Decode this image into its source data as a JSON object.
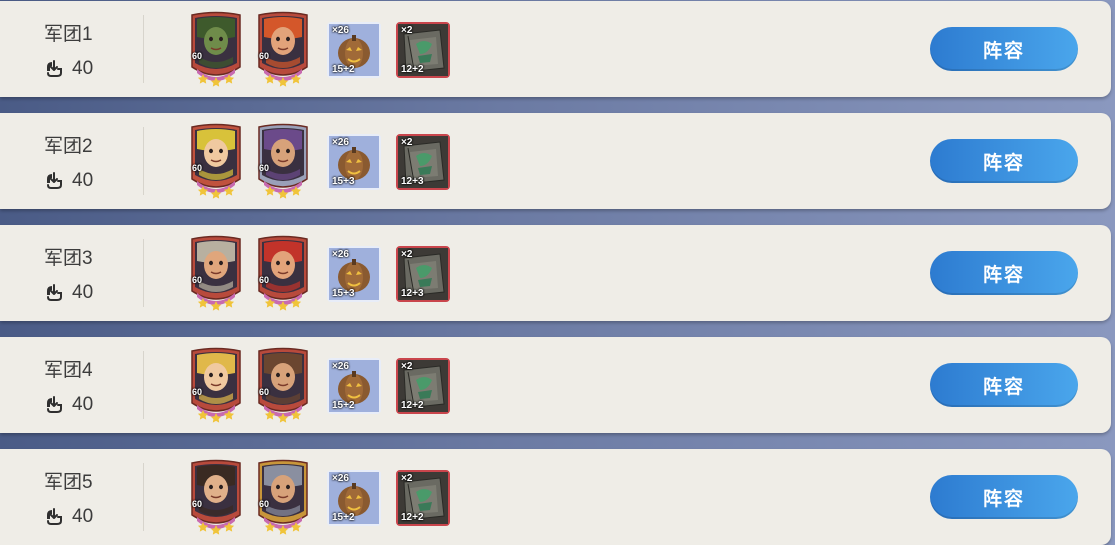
{
  "legions": [
    {
      "name": "军团1",
      "power": "40",
      "heroes": [
        {
          "level": "60",
          "frame_color": "#b84a3c",
          "skin": "#6f8c4a",
          "hair": "#3e5a2c",
          "icon": "hero-portrait-green-knight-icon"
        },
        {
          "level": "60",
          "frame_color": "#b84a3c",
          "skin": "#e2a37a",
          "hair": "#d4572a",
          "icon": "hero-portrait-red-hair-woman-icon"
        }
      ],
      "items": [
        {
          "qty": "×26",
          "level": "15+2",
          "icon": "pumpkin-relic-icon"
        },
        {
          "qty": "×2",
          "level": "12+2",
          "icon": "stone-slab-relic-icon"
        }
      ],
      "button": "阵容"
    },
    {
      "name": "军团2",
      "power": "40",
      "heroes": [
        {
          "level": "60",
          "frame_color": "#c0523e",
          "skin": "#f0c9a0",
          "hair": "#d8c23a",
          "icon": "hero-portrait-blonde-hero-icon"
        },
        {
          "level": "60",
          "frame_color": "#9aa0b8",
          "skin": "#d7a27a",
          "hair": "#6b4a8a",
          "icon": "hero-portrait-masked-warrior-icon"
        }
      ],
      "items": [
        {
          "qty": "×26",
          "level": "15+3",
          "icon": "pumpkin-relic-icon"
        },
        {
          "qty": "×2",
          "level": "12+3",
          "icon": "stone-slab-relic-icon"
        }
      ],
      "button": "阵容"
    },
    {
      "name": "军团3",
      "power": "40",
      "heroes": [
        {
          "level": "60",
          "frame_color": "#b84a3c",
          "skin": "#e0a67c",
          "hair": "#b8b0a0",
          "icon": "hero-portrait-dwarf-helmet-icon"
        },
        {
          "level": "60",
          "frame_color": "#b84a3c",
          "skin": "#e2a37a",
          "hair": "#c2332a",
          "icon": "hero-portrait-red-dwarf-icon"
        }
      ],
      "items": [
        {
          "qty": "×26",
          "level": "15+3",
          "icon": "pumpkin-relic-icon"
        },
        {
          "qty": "×2",
          "level": "12+3",
          "icon": "stone-slab-relic-icon"
        }
      ],
      "button": "阵容"
    },
    {
      "name": "军团4",
      "power": "40",
      "heroes": [
        {
          "level": "60",
          "frame_color": "#b84a3c",
          "skin": "#f0c9a0",
          "hair": "#e0b84a",
          "icon": "hero-portrait-blonde-youth-icon"
        },
        {
          "level": "60",
          "frame_color": "#b84a3c",
          "skin": "#d7a27a",
          "hair": "#6b4630",
          "icon": "hero-portrait-brown-hair-man-icon"
        }
      ],
      "items": [
        {
          "qty": "×26",
          "level": "15+2",
          "icon": "pumpkin-relic-icon"
        },
        {
          "qty": "×2",
          "level": "12+2",
          "icon": "stone-slab-relic-icon"
        }
      ],
      "button": "阵容"
    },
    {
      "name": "军团5",
      "power": "40",
      "heroes": [
        {
          "level": "60",
          "frame_color": "#b84a3c",
          "skin": "#e0b08a",
          "hair": "#3a2a22",
          "icon": "hero-portrait-dark-hair-youth-icon"
        },
        {
          "level": "60",
          "frame_color": "#c8963a",
          "skin": "#d7a27a",
          "hair": "#8a8fa0",
          "icon": "hero-portrait-armored-elder-icon"
        }
      ],
      "items": [
        {
          "qty": "×26",
          "level": "15+2",
          "icon": "pumpkin-relic-icon"
        },
        {
          "qty": "×2",
          "level": "12+2",
          "icon": "stone-slab-relic-icon"
        }
      ],
      "button": "阵容"
    }
  ],
  "power_icon": "troop-power-icon",
  "colors": {
    "button_start": "#2d7bd0",
    "button_end": "#4aa6ec",
    "row_bg": "#efede7",
    "item_blue_border": "#e8edf8",
    "item_red_border": "#c9454c",
    "star_color": "#f0c43a",
    "star_band": "#c86ab0"
  }
}
